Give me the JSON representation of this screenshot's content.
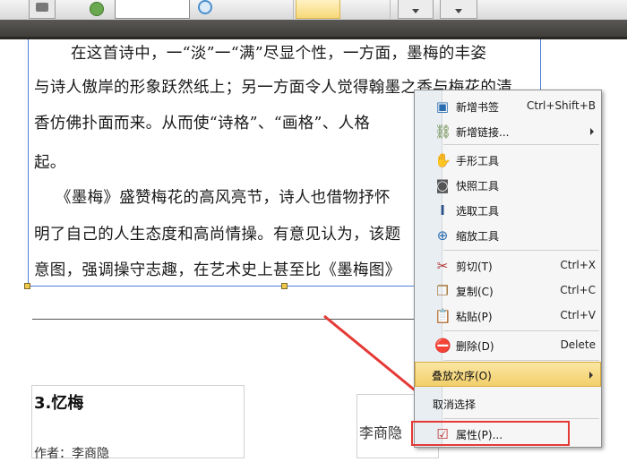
{
  "document": {
    "paragraph_lines": [
      "在这首诗中，一“淡”一“满”尽显个性，一方面，墨梅的丰姿",
      "与诗人傲岸的形象跃然纸上；另一方面令人觉得翰墨之香与梅花的清",
      "香仿佛扑面而来。从而使“诗格”、“画格”、人格",
      "起。",
      "《墨梅》盛赞梅花的高风亮节，诗人也借物抒怀",
      "明了自己的人生态度和高尚情操。有意见认为，该题",
      "意图，强调操守志趣，在艺术史上甚至比《墨梅图》"
    ],
    "section_title": "3.忆梅",
    "author_name": "李商隐",
    "partial_line": "作者：李商隐"
  },
  "context_menu": {
    "items": [
      {
        "label": "新增书签",
        "shortcut": "Ctrl+Shift+B",
        "icon": "bookmark-icon",
        "glyph": "▣"
      },
      {
        "label": "新增链接...",
        "shortcut": "",
        "icon": "link-icon",
        "glyph": "⛓",
        "submenu": true
      },
      {
        "label": "手形工具",
        "shortcut": "",
        "icon": "hand-icon",
        "glyph": "✋"
      },
      {
        "label": "快照工具",
        "shortcut": "",
        "icon": "camera-icon",
        "glyph": "◙"
      },
      {
        "label": "选取工具",
        "shortcut": "",
        "icon": "text-select-icon",
        "glyph": "I"
      },
      {
        "label": "缩放工具",
        "shortcut": "",
        "icon": "zoom-icon",
        "glyph": "⊕"
      },
      {
        "label": "剪切(T)",
        "shortcut": "Ctrl+X",
        "icon": "scissors-icon",
        "glyph": "✂"
      },
      {
        "label": "复制(C)",
        "shortcut": "Ctrl+C",
        "icon": "copy-icon",
        "glyph": "❐"
      },
      {
        "label": "粘贴(P)",
        "shortcut": "Ctrl+V",
        "icon": "paste-icon",
        "glyph": "📋"
      },
      {
        "label": "删除(D)",
        "shortcut": "Delete",
        "icon": "delete-icon",
        "glyph": "⛔"
      },
      {
        "label": "叠放次序(O)",
        "shortcut": "",
        "icon": "",
        "glyph": "",
        "submenu": true
      },
      {
        "label": "取消选择",
        "shortcut": "",
        "icon": "",
        "glyph": ""
      },
      {
        "label": "属性(P)...",
        "shortcut": "",
        "icon": "properties-icon",
        "glyph": "☑"
      }
    ]
  },
  "colors": {
    "selection_border": "#4f7fd8",
    "highlight_red": "#e53935",
    "menu_active": "#f2cf6a"
  }
}
